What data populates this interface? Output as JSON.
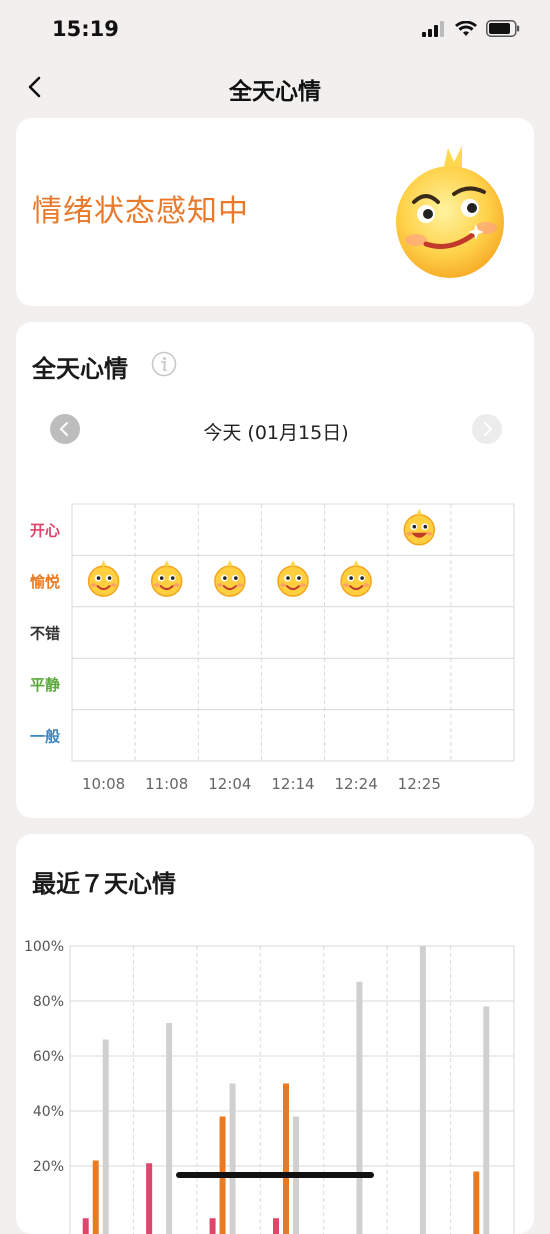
{
  "status_bar": {
    "time": "15:19"
  },
  "nav": {
    "title": "全天心情"
  },
  "emotion_status": {
    "text": "情绪状态感知中"
  },
  "daily_mood": {
    "title": "全天心情",
    "date_label": "今天 (01月15日)",
    "levels": [
      {
        "label": "开心",
        "color": "#e0456b"
      },
      {
        "label": "愉悦",
        "color": "#ea7a21"
      },
      {
        "label": "不错",
        "color": "#333333"
      },
      {
        "label": "平静",
        "color": "#5aa83a"
      },
      {
        "label": "一般",
        "color": "#3a86c2"
      }
    ],
    "times": [
      "10:08",
      "11:08",
      "12:04",
      "12:14",
      "12:24",
      "12:25"
    ],
    "entries": [
      {
        "time": "10:08",
        "level": "愉悦"
      },
      {
        "time": "11:08",
        "level": "愉悦"
      },
      {
        "time": "12:04",
        "level": "愉悦"
      },
      {
        "time": "12:14",
        "level": "愉悦"
      },
      {
        "time": "12:24",
        "level": "愉悦"
      },
      {
        "time": "12:25",
        "level": "开心"
      }
    ]
  },
  "weekly_mood": {
    "title": "最近７天心情"
  },
  "chart_data": {
    "type": "bar",
    "categories": [
      "",
      "",
      "",
      "",
      "",
      "",
      ""
    ],
    "series": [
      {
        "color": "#e0456b",
        "values": [
          1,
          21,
          1,
          1,
          0,
          0,
          0
        ]
      },
      {
        "color": "#ea7a21",
        "values": [
          22,
          0,
          38,
          50,
          0,
          0,
          18
        ]
      },
      {
        "color": "#d0d0d0",
        "values": [
          66,
          72,
          50,
          38,
          87,
          100,
          78
        ]
      }
    ],
    "y_ticks": [
      "20%",
      "40%",
      "60%",
      "80%",
      "100%"
    ],
    "ylim": [
      0,
      100
    ],
    "grid": true
  }
}
